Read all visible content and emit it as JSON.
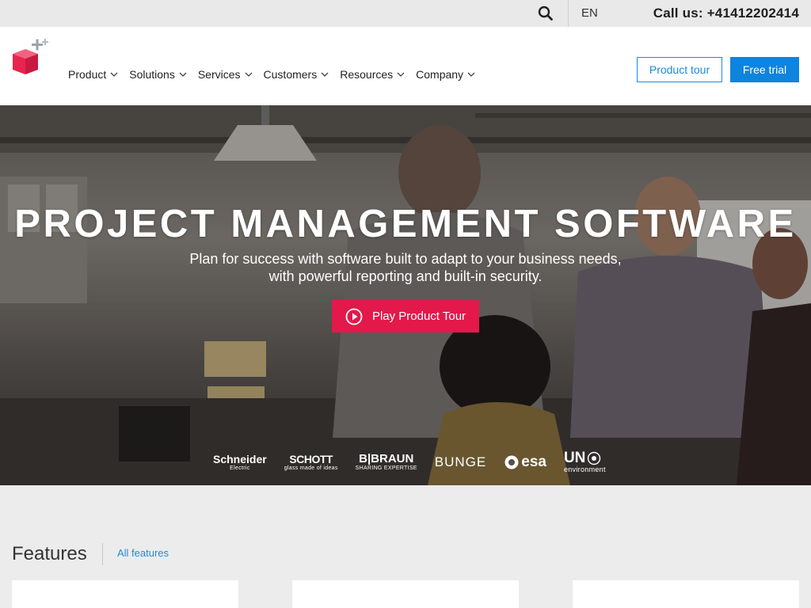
{
  "topbar": {
    "language": "EN",
    "call_text": "Call us: +41412202414"
  },
  "nav": {
    "items": [
      {
        "label": "Product"
      },
      {
        "label": "Solutions"
      },
      {
        "label": "Services"
      },
      {
        "label": "Customers"
      },
      {
        "label": "Resources"
      },
      {
        "label": "Company"
      }
    ],
    "product_tour_label": "Product tour",
    "free_trial_label": "Free trial"
  },
  "hero": {
    "title": "PROJECT MANAGEMENT SOFTWARE",
    "subtitle_line1": "Plan for success with software built to adapt to your business needs,",
    "subtitle_line2": "with powerful reporting and built-in security.",
    "play_button_label": "Play Product Tour",
    "clients": [
      {
        "name": "Schneider",
        "tagline": "Electric"
      },
      {
        "name": "SCHOTT",
        "tagline": "glass made of ideas"
      },
      {
        "name": "B|BRAUN",
        "tagline": "SHARING EXPERTISE"
      },
      {
        "name": "BUNGE",
        "tagline": ""
      },
      {
        "name": "esa",
        "tagline": ""
      },
      {
        "name": "UN",
        "tagline": "environment"
      }
    ]
  },
  "features": {
    "title": "Features",
    "link_label": "All features"
  },
  "colors": {
    "accent_blue": "#0d84de",
    "accent_red": "#e3194b"
  }
}
